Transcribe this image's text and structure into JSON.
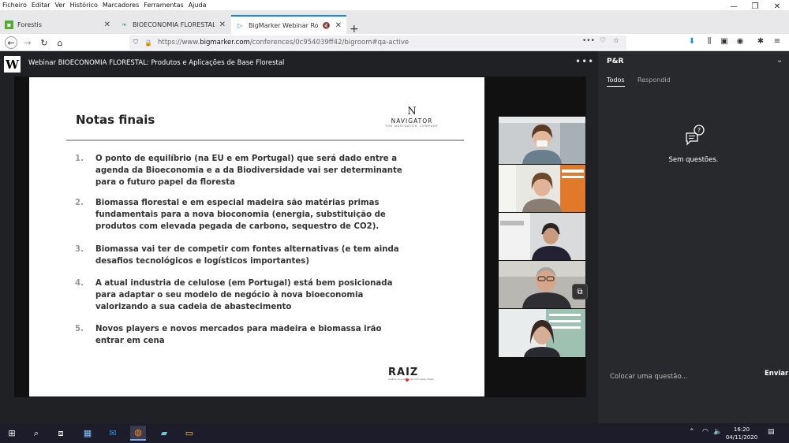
{
  "menubar": {
    "items": [
      "Ficheiro",
      "Editar",
      "Ver",
      "Histórico",
      "Marcadores",
      "Ferramentas",
      "Ajuda"
    ]
  },
  "window_controls": {
    "minimize": "—",
    "restore": "❐",
    "close": "✕"
  },
  "tabs": [
    {
      "title": "Forestis",
      "active": false,
      "icon": "forestis-favicon"
    },
    {
      "title": "BIOECONOMIA FLORESTAL: Pro",
      "active": false,
      "icon": "leaf-favicon"
    },
    {
      "title": "BigMarker Webinar Room",
      "active": true,
      "icon": "bigmarker-favicon"
    }
  ],
  "newtab_label": "+",
  "navbar": {
    "url_prefix": "https://www.",
    "url_domain": "bigmarker.com",
    "url_path": "/conferences/0c954039ff42/bigroom#qa-active",
    "page_actions": "•••"
  },
  "webinar": {
    "logo": "W",
    "title": "Webinar BIOECONOMIA FLORESTAL: Produtos e Aplicações de Base Florestal",
    "more": "•••"
  },
  "slide": {
    "title": "Notas finais",
    "company_logo": {
      "mark": "N",
      "word": "NAVIGATOR",
      "sub": "THE NAVIGATOR COMPANY"
    },
    "items": [
      {
        "num": "1.",
        "text": "O ponto de equilíbrio (na EU e em Portugal) que será dado entre a agenda da Bioeconomia e a da Biodiversidade vai ser determinante para o futuro papel da floresta"
      },
      {
        "num": "2.",
        "text": "Biomassa florestal e em especial madeira são matérias primas fundamentais para a nova bioconomia (energia, substituição de produtos com elevada pegada de carbono, sequestro de CO2)."
      },
      {
        "num": "3.",
        "text": "Biomassa vai ter de competir com fontes alternativas (e tem ainda desafios tecnológicos e logísticos importantes)"
      },
      {
        "num": "4.",
        "text": "A atual industria de celulose (em Portugal) está bem posicionada para adaptar o seu modelo de negócio à nova bioeconomia valorizando a sua cadeia de abastecimento"
      },
      {
        "num": "5.",
        "text": "Novos players e novos mercados para madeira e biomassa irão entrar em cena"
      }
    ],
    "footer_logo": {
      "word": "RAIZ",
      "sub": "Instituto de Investigação da Floresta e Papel"
    }
  },
  "qa": {
    "title": "P&R",
    "tabs": [
      "Todos",
      "Respondid"
    ],
    "empty_text": "Sem questões.",
    "input_placeholder": "Colocar uma questão...",
    "send_label": "Enviar"
  },
  "taskbar": {
    "time": "16:20",
    "date": "04/11/2020"
  },
  "colors": {
    "accent": "#0a84ff",
    "app_dark": "#202124",
    "panel": "#28292c"
  }
}
